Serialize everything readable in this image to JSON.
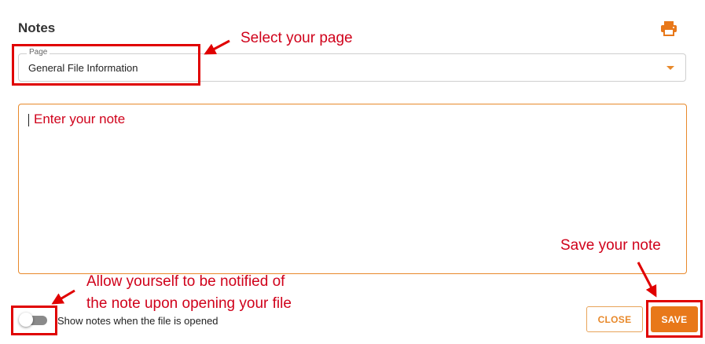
{
  "header": {
    "title": "Notes"
  },
  "page_select": {
    "legend": "Page",
    "value": "General File Information"
  },
  "note": {
    "placeholder": "Enter your note"
  },
  "toggle": {
    "label": "Show notes when the file is opened",
    "on": false
  },
  "actions": {
    "close_label": "CLOSE",
    "save_label": "SAVE"
  },
  "annotations": {
    "select_page": "Select your page",
    "save_note": "Save your note",
    "notify_line1": "Allow yourself to be notified of",
    "notify_line2": "the note upon opening your file"
  },
  "colors": {
    "accent": "#e8781a",
    "annotation": "#e00000"
  }
}
